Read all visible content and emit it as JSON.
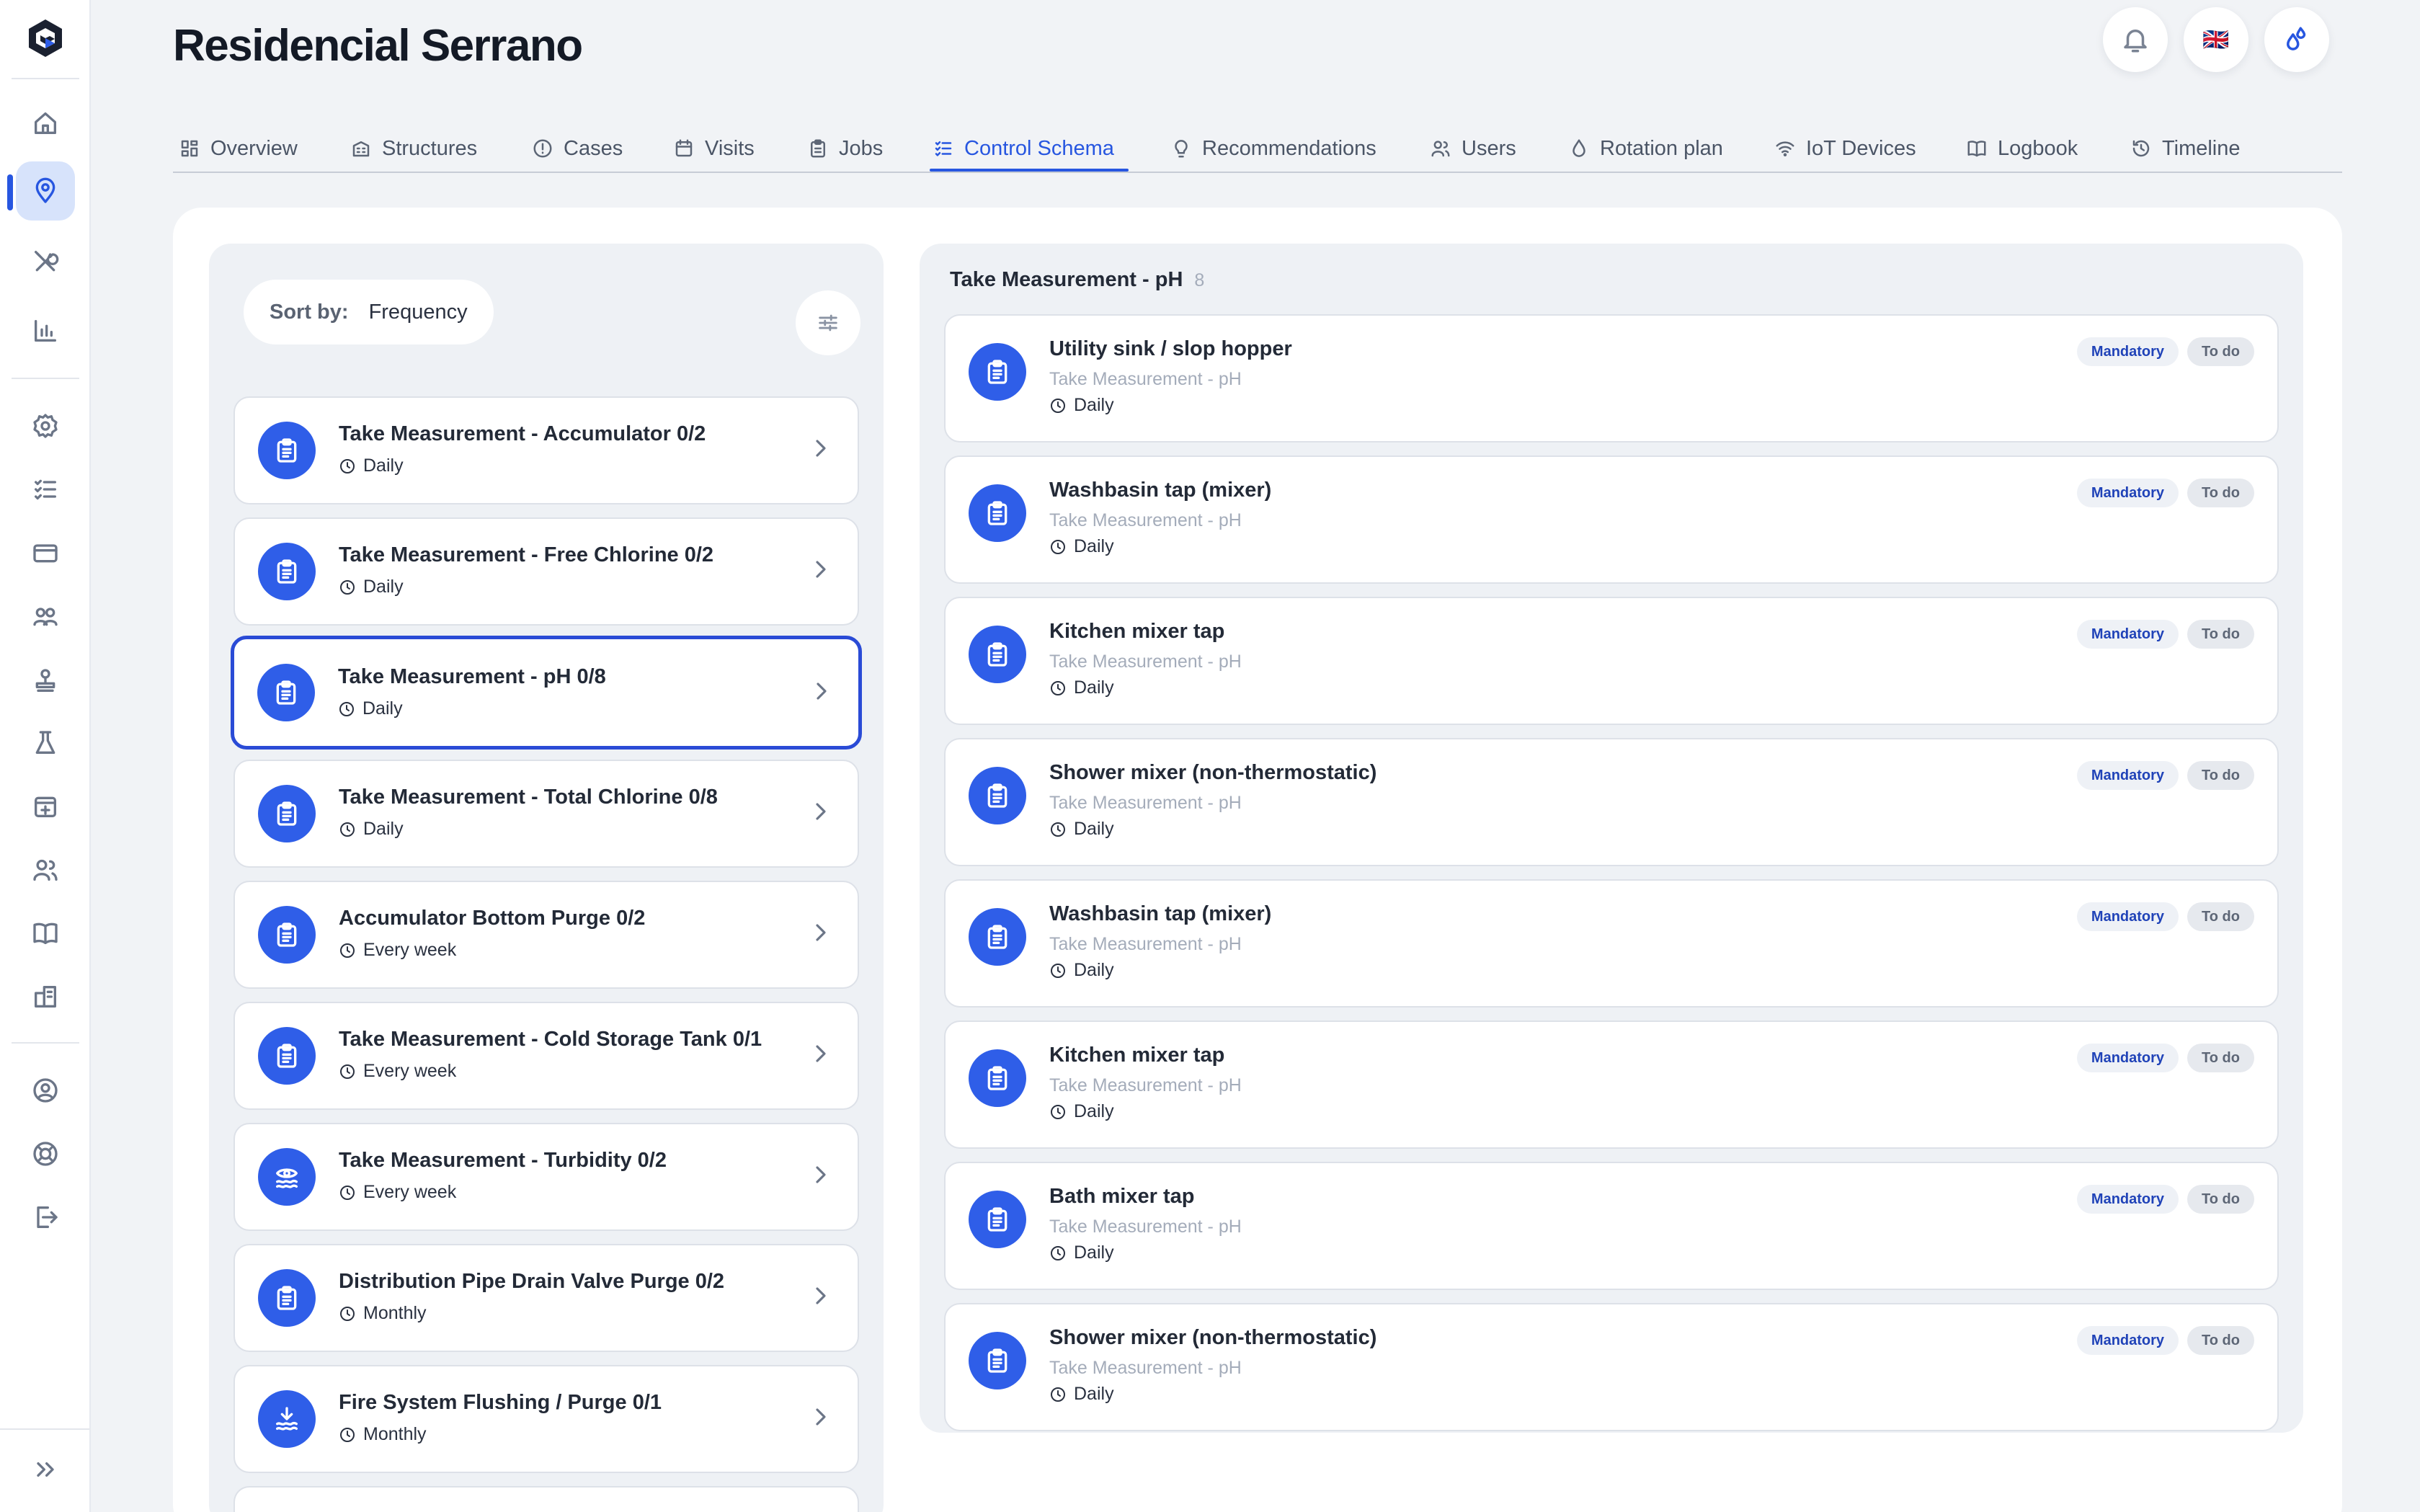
{
  "page": {
    "title": "Residencial Serrano"
  },
  "header": {
    "language_flag": "🇬🇧"
  },
  "tabs": [
    {
      "label": "Overview",
      "icon": "dashboard-icon"
    },
    {
      "label": "Structures",
      "icon": "building-icon"
    },
    {
      "label": "Cases",
      "icon": "alert-circle-icon"
    },
    {
      "label": "Visits",
      "icon": "calendar-icon"
    },
    {
      "label": "Jobs",
      "icon": "clipboard-icon"
    },
    {
      "label": "Control Schema",
      "icon": "checklist-icon",
      "active": true
    },
    {
      "label": "Recommendations",
      "icon": "lightbulb-icon"
    },
    {
      "label": "Users",
      "icon": "users-icon"
    },
    {
      "label": "Rotation plan",
      "icon": "droplet-icon"
    },
    {
      "label": "IoT Devices",
      "icon": "wifi-icon"
    },
    {
      "label": "Logbook",
      "icon": "book-icon"
    },
    {
      "label": "Timeline",
      "icon": "history-icon"
    }
  ],
  "sort": {
    "label": "Sort by:",
    "value": "Frequency"
  },
  "tasks": [
    {
      "title": "Take Measurement - Accumulator 0/2",
      "frequency": "Daily",
      "icon": "clipboard-icon"
    },
    {
      "title": "Take Measurement - Free Chlorine 0/2",
      "frequency": "Daily",
      "icon": "clipboard-icon"
    },
    {
      "title": "Take Measurement - pH 0/8",
      "frequency": "Daily",
      "icon": "clipboard-icon",
      "selected": true
    },
    {
      "title": "Take Measurement - Total Chlorine 0/8",
      "frequency": "Daily",
      "icon": "clipboard-icon"
    },
    {
      "title": "Accumulator Bottom Purge 0/2",
      "frequency": "Every week",
      "icon": "clipboard-icon"
    },
    {
      "title": "Take Measurement - Cold Storage Tank 0/1",
      "frequency": "Every week",
      "icon": "clipboard-icon"
    },
    {
      "title": "Take Measurement - Turbidity 0/2",
      "frequency": "Every week",
      "icon": "eye-water-icon"
    },
    {
      "title": "Distribution Pipe Drain Valve Purge 0/2",
      "frequency": "Monthly",
      "icon": "clipboard-icon"
    },
    {
      "title": "Fire System Flushing / Purge 0/1",
      "frequency": "Monthly",
      "icon": "flush-icon"
    }
  ],
  "detail": {
    "title": "Take Measurement - pH",
    "count": "8",
    "items": [
      {
        "title": "Utility sink / slop hopper",
        "subtitle": "Take Measurement - pH",
        "frequency": "Daily",
        "badge_primary": "Mandatory",
        "badge_status": "To do"
      },
      {
        "title": "Washbasin tap (mixer)",
        "subtitle": "Take Measurement - pH",
        "frequency": "Daily",
        "badge_primary": "Mandatory",
        "badge_status": "To do"
      },
      {
        "title": "Kitchen mixer tap",
        "subtitle": "Take Measurement - pH",
        "frequency": "Daily",
        "badge_primary": "Mandatory",
        "badge_status": "To do"
      },
      {
        "title": "Shower mixer (non-thermostatic)",
        "subtitle": "Take Measurement - pH",
        "frequency": "Daily",
        "badge_primary": "Mandatory",
        "badge_status": "To do"
      },
      {
        "title": "Washbasin tap (mixer)",
        "subtitle": "Take Measurement - pH",
        "frequency": "Daily",
        "badge_primary": "Mandatory",
        "badge_status": "To do"
      },
      {
        "title": "Kitchen mixer tap",
        "subtitle": "Take Measurement - pH",
        "frequency": "Daily",
        "badge_primary": "Mandatory",
        "badge_status": "To do"
      },
      {
        "title": "Bath mixer tap",
        "subtitle": "Take Measurement - pH",
        "frequency": "Daily",
        "badge_primary": "Mandatory",
        "badge_status": "To do"
      },
      {
        "title": "Shower mixer (non-thermostatic)",
        "subtitle": "Take Measurement - pH",
        "frequency": "Daily",
        "badge_primary": "Mandatory",
        "badge_status": "To do"
      }
    ]
  },
  "colors": {
    "accent": "#2756e0",
    "icon_bg": "#2f5ee8",
    "panel": "#eef1f5"
  }
}
